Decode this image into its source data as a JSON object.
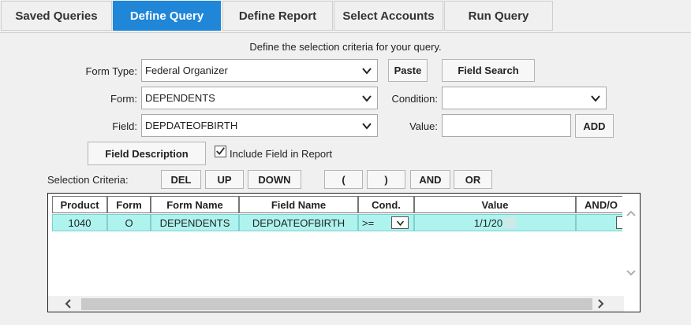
{
  "tabs": [
    {
      "label": "Saved Queries"
    },
    {
      "label": "Define Query"
    },
    {
      "label": "Define Report"
    },
    {
      "label": "Select Accounts"
    },
    {
      "label": "Run Query"
    }
  ],
  "active_tab": "Define Query",
  "hint": "Define the selection criteria for your query.",
  "form": {
    "form_type_label": "Form Type:",
    "form_type_value": "Federal Organizer",
    "form_label": "Form:",
    "form_value": "DEPENDENTS",
    "field_label": "Field:",
    "field_value": "DEPDATEOFBIRTH",
    "condition_label": "Condition:",
    "condition_value": "",
    "value_label": "Value:",
    "value_value": ""
  },
  "buttons": {
    "paste": "Paste",
    "field_search": "Field Search",
    "add": "ADD",
    "field_description": "Field Description",
    "del": "DEL",
    "up": "UP",
    "down": "DOWN",
    "open_paren": "(",
    "close_paren": ")",
    "and": "AND",
    "or": "OR"
  },
  "include_field": {
    "label": "Include Field in Report",
    "checked": true
  },
  "selection_criteria_label": "Selection Criteria:",
  "grid": {
    "headers": [
      "Product",
      "Form",
      "Form Name",
      "Field Name",
      "Cond.",
      "Value",
      "AND/O"
    ],
    "rows": [
      {
        "product": "1040",
        "form": "O",
        "form_name": "DEPENDENTS",
        "field_name": "DEPDATEOFBIRTH",
        "cond": ">=",
        "value": "1/1/20",
        "and_or": ""
      }
    ]
  }
}
